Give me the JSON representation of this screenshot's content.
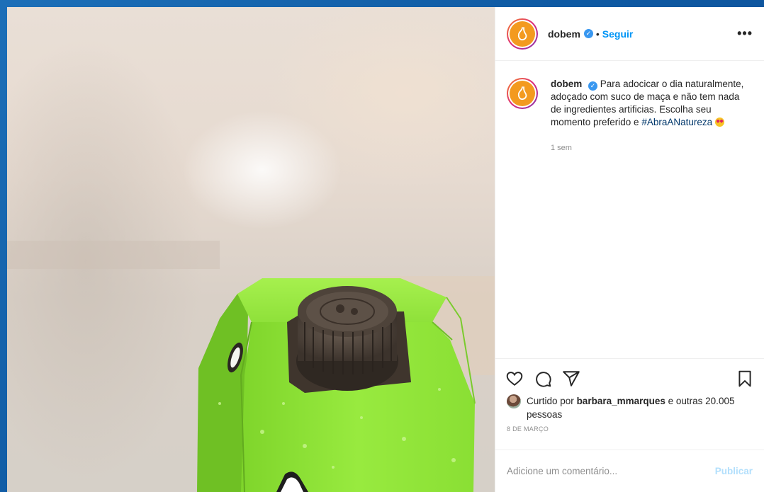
{
  "post": {
    "username": "dobem",
    "separator": "•",
    "follow_label": "Seguir",
    "more_label": "•••",
    "verified_mark": "✓",
    "caption_text": "Para adocicar o dia naturalmente, adoçado com suco de maça e não tem nada de ingredientes artificias. Escolha seu momento preferido e",
    "caption_hashtag": "#AbraANatureza",
    "time_ago": "1 sem",
    "likes_prefix": "Curtido por",
    "likes_user": "barbara_mmarques",
    "likes_suffix": "e outras 20.005 pessoas",
    "date": "8 DE MARÇO",
    "comment_placeholder": "Adicione um comentário...",
    "publish_label": "Publicar"
  },
  "colors": {
    "brand_avatar": "#f39a1f",
    "link_blue": "#0095f6",
    "verified_blue": "#3897f0",
    "carton_green": "#8be035",
    "cap_brown": "#4a3f37"
  },
  "icons": [
    "heart-icon",
    "comment-icon",
    "share-icon",
    "bookmark-icon",
    "more-options-icon",
    "verified-icon",
    "heart-eyes-emoji"
  ]
}
